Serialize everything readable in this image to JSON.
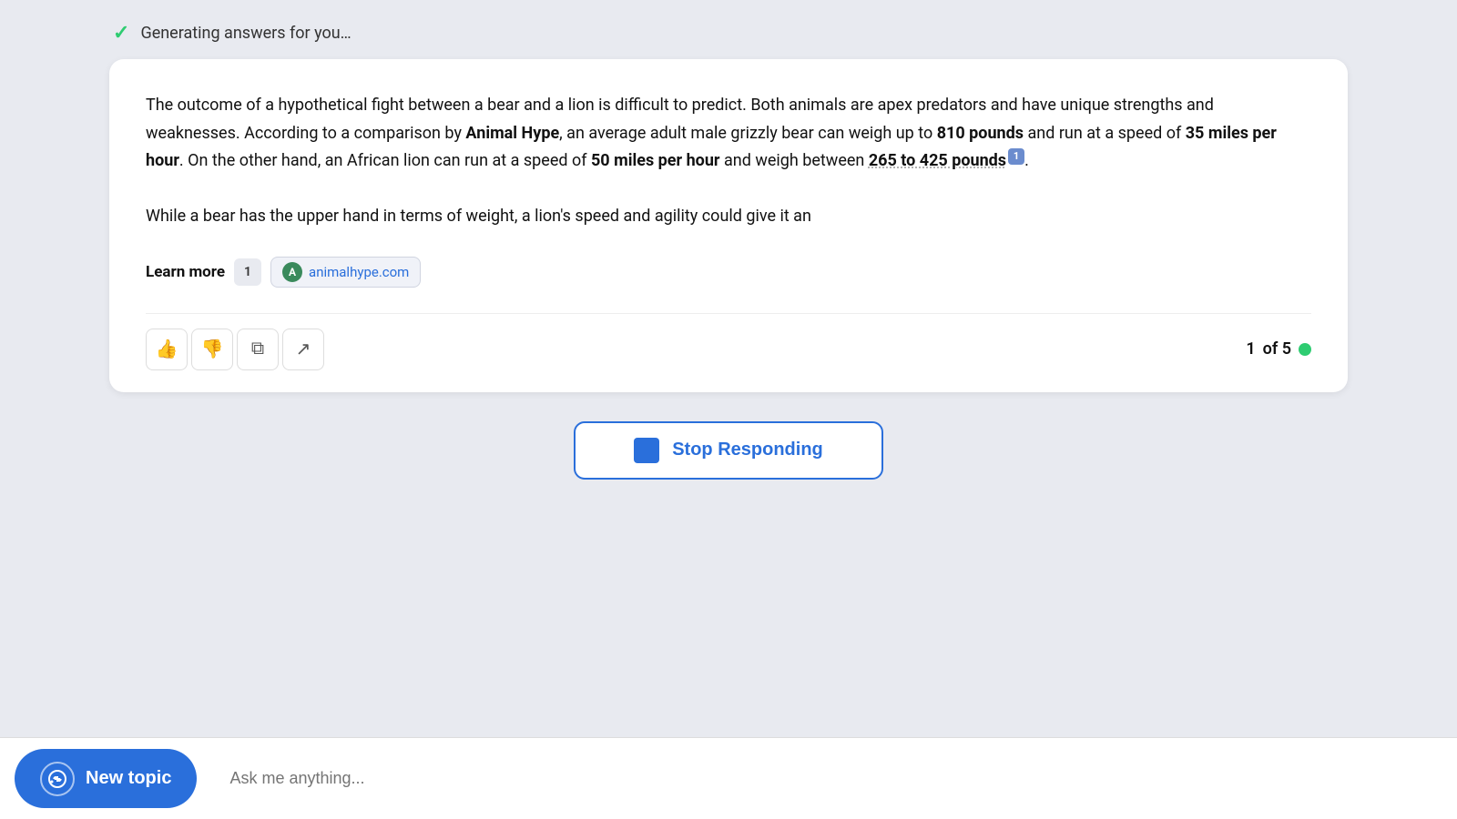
{
  "status": {
    "text": "Generating answers for you…",
    "icon": "✓"
  },
  "answer": {
    "paragraph1": "The outcome of a hypothetical fight between a bear and a lion is difficult to predict. Both animals are apex predators and have unique strengths and weaknesses. According to a comparison by ",
    "bold_animal_hype": "Animal Hype",
    "paragraph1b": ", an average adult male grizzly bear can weigh up to ",
    "bold_810": "810 pounds",
    "paragraph1c": " and run at a speed of ",
    "bold_35": "35 miles per hour",
    "paragraph1d": ". On the other hand, an African lion can run at a speed of ",
    "bold_50": "50 miles per hour",
    "paragraph1e": " and weigh between ",
    "bold_265": "265 to 425 pounds",
    "citation_num": "1",
    "paragraph1f": ".",
    "paragraph2": "While a bear has the upper hand in terms of weight, a lion's speed and agility could give it an",
    "learn_more_label": "Learn more",
    "learn_more_num": "1",
    "link_avatar_letter": "A",
    "link_url": "animalhype.com"
  },
  "actions": {
    "page_current": "1",
    "page_total": "5",
    "of_label": "of 5"
  },
  "stop_button": {
    "label": "Stop Responding"
  },
  "bottom": {
    "new_topic_label": "New topic",
    "input_placeholder": "Ask me anything..."
  }
}
